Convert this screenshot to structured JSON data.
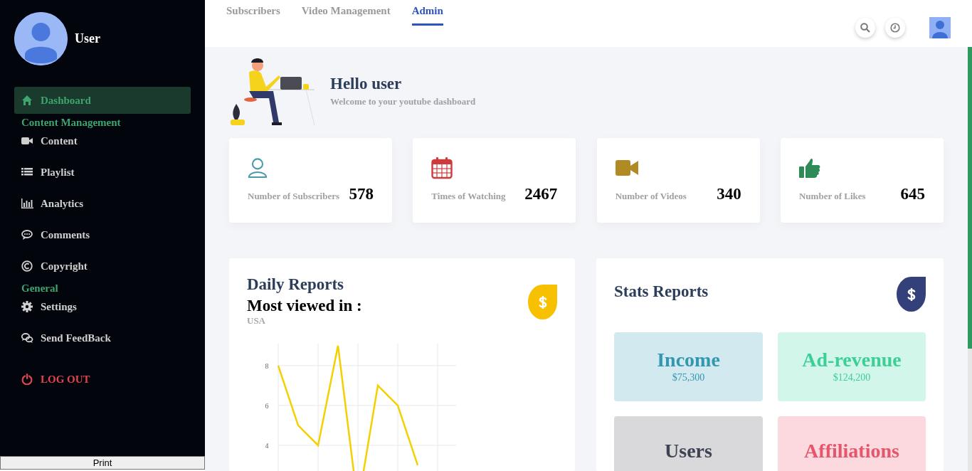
{
  "sidebar": {
    "user_name": "User",
    "nav": [
      {
        "kind": "item",
        "label": "Dashboard",
        "selected": true
      },
      {
        "kind": "section",
        "label": "Content Management"
      },
      {
        "kind": "item",
        "label": "Content",
        "selected": false
      },
      {
        "kind": "item",
        "label": "Playlist",
        "selected": false
      },
      {
        "kind": "item",
        "label": "Analytics",
        "selected": false
      },
      {
        "kind": "item",
        "label": "Comments",
        "selected": false
      },
      {
        "kind": "item",
        "label": "Copyright",
        "selected": false
      },
      {
        "kind": "section",
        "label": "General"
      },
      {
        "kind": "item",
        "label": "Settings",
        "selected": false
      },
      {
        "kind": "item",
        "label": "Send FeedBack",
        "selected": false
      },
      {
        "kind": "logout",
        "label": "LOG OUT"
      }
    ],
    "print_button": "Print"
  },
  "tabs": [
    {
      "label": "Subscribers",
      "selected": false
    },
    {
      "label": "Video Management",
      "selected": false
    },
    {
      "label": "Admin",
      "selected": true
    }
  ],
  "hero": {
    "title": "Hello user",
    "subtitle": "Welcome to your youtube dashboard"
  },
  "stat_cards": [
    {
      "label": "Number of Subscribers",
      "value": "578"
    },
    {
      "label": "Times of Watching",
      "value": "2467"
    },
    {
      "label": "Number of Videos",
      "value": "340"
    },
    {
      "label": "Number of Likes",
      "value": "645"
    }
  ],
  "daily_reports": {
    "title": "Daily Reports",
    "subtitle": "Most viewed in :",
    "country": "USA",
    "chart_data": {
      "type": "line",
      "categories": [
        null,
        null,
        null,
        null,
        null,
        null,
        null,
        null
      ],
      "series": [
        {
          "color": "#f5d000",
          "values": [
            8,
            5,
            4,
            9,
            1,
            7,
            6,
            3
          ]
        }
      ],
      "grid": true,
      "ylim": [
        0,
        9.1
      ],
      "yticks": [
        4,
        6,
        8
      ]
    }
  },
  "stats_reports": {
    "title": "Stats Reports",
    "tiles": [
      {
        "title": "Income",
        "amount": "$75,300"
      },
      {
        "title": "Ad-revenue",
        "amount": "$124,200"
      },
      {
        "title": "Users"
      },
      {
        "title": "Affiliations"
      }
    ]
  }
}
